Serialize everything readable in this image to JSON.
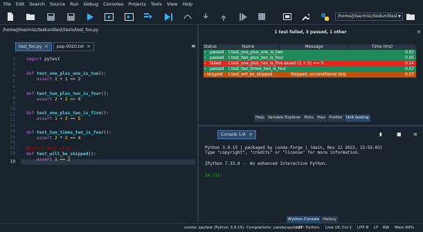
{
  "menubar": {
    "items": [
      "File",
      "Edit",
      "Search",
      "Source",
      "Run",
      "Debug",
      "Consoles",
      "Projects",
      "Tools",
      "View",
      "Help"
    ]
  },
  "toolbar": {
    "icons": [
      "new-file-icon",
      "open-folder-icon",
      "save-icon",
      "save-all-icon",
      "run-icon",
      "run-cell-icon",
      "run-cell-advance-icon",
      "run-selection-icon",
      "debug-icon",
      "debug-cell-icon",
      "step-icon",
      "continue-icon",
      "stop-icon",
      "stop-debug-icon",
      "maximize-pane-icon",
      "preferences-icon",
      "python-path-icon",
      "browse-folder-icon"
    ],
    "working_dir": "/home/jitse/misc/testunittest"
  },
  "editor": {
    "file_path": "/home/jitse/misc/testunittest/tests/test_foo.py",
    "tabs": [
      {
        "label": "test_foo.py",
        "active": true
      },
      {
        "label": "pep-0020.txt",
        "active": false
      }
    ],
    "line_numbers": [
      "1",
      "2",
      "3",
      "4",
      "5",
      "6",
      "7",
      "8",
      "9",
      "10",
      "11",
      "12",
      "13",
      "14",
      "15",
      "16",
      "17",
      "18",
      "19"
    ],
    "current_line": "19",
    "code": {
      "l1_kw": "import",
      "l1_rest": " pytest",
      "l4_kw": "def",
      "l4_fn": "test_one_plus_one_is_two",
      "l4_rest": "():",
      "l5_kw": "assert",
      "l5_a": "1",
      "l5_op": " + ",
      "l5_b": "1",
      "l5_eq": " == ",
      "l5_c": "2",
      "l8_kw": "def",
      "l8_fn": "test_two_plus_two_is_four",
      "l8_rest": "():",
      "l9_kw": "assert",
      "l9_a": "2",
      "l9_op": " + ",
      "l9_b": "2",
      "l9_eq": " == ",
      "l9_c": "4",
      "l12_kw": "def",
      "l12_fn": "test_one_plus_two_is_five",
      "l12_rest": "():",
      "l13_kw": "assert",
      "l13_a": "1",
      "l13_op": " + ",
      "l13_b": "2",
      "l13_eq": " == ",
      "l13_c": "5",
      "l16_kw": "def",
      "l16_fn": "test_two_times_two_is_four",
      "l16_rest": "():",
      "l17_kw": "assert",
      "l17_a": "2",
      "l17_op": " * ",
      "l17_b": "2",
      "l17_eq": " == ",
      "l17_c": "4",
      "l20_deco": "@pytest.mark.skip",
      "l21_kw": "def",
      "l21_fn": "test_will_be_skipped",
      "l21_rest": "():",
      "l22_kw": "assert",
      "l22_a": "1",
      "l22_eq": " == ",
      "l22_c": "2"
    }
  },
  "unit_testing": {
    "summary": "1 test failed, 3 passed, 1 other",
    "columns": [
      "Status",
      "Name",
      "Message",
      "Time (ms)"
    ],
    "rows": [
      {
        "status": "passed",
        "name": "t.test_one_plus_one_is_two",
        "message": "",
        "time": "0.07"
      },
      {
        "status": "passed",
        "name": "t.test_two_plus_two_is_four",
        "message": "",
        "time": "0.05"
      },
      {
        "status": "failed",
        "name": "t.test_one_plus_two_is_five",
        "message": "assert (1 + 2) == 5",
        "time": "0.14"
      },
      {
        "status": "passed",
        "name": "t.test_two_times_two_is_four",
        "message": "",
        "time": "0.07"
      },
      {
        "status": "skipped",
        "name": "t.test_will_be_skipped",
        "message": "Skipped: unconditional skip",
        "time": "0.07"
      }
    ],
    "pane_tabs": [
      "Help",
      "Variable Explorer",
      "Plots",
      "Files",
      "Profiler",
      "Unit testing"
    ],
    "active_tab": "Unit testing"
  },
  "console": {
    "tab_label": "Console 1/A",
    "lines": {
      "l1": "Python 3.9.15 | packaged by conda-forge | (main, Nov 22 2022, 15:55:03)",
      "l2": "Type \"copyright\", \"credits\" or \"license\" for more information.",
      "l3": "IPython 7.33.0 -- An enhanced Interactive Python.",
      "prompt": "In [1]:"
    },
    "pane_tabs": [
      "IPython Console",
      "History"
    ],
    "active_tab": "IPython Console"
  },
  "statusbar": {
    "env": "conda: spytest (Python 3.9.15)",
    "completions": "Completions: conda(spytest)",
    "lsp": "LSP: Python",
    "position": "Line 19, Col 1",
    "encoding": "UTF-8",
    "eol": "LF",
    "rw": "RW",
    "mem": "Mem 69%"
  },
  "colors": {
    "passed": "#21895a",
    "failed": "#e0261f",
    "skipped": "#c0520c",
    "background": "#19232d"
  }
}
